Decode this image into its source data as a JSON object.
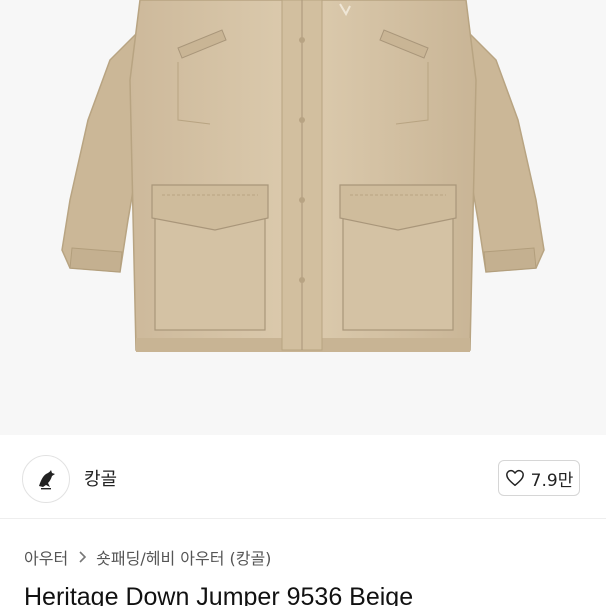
{
  "product": {
    "image_icon": "jacket-image",
    "title": "Heritage Down Jumper 9536 Beige"
  },
  "brand": {
    "name": "캉골",
    "logo_icon": "kangaroo-logo-icon"
  },
  "like": {
    "icon": "heart-outline-icon",
    "count": "7.9만"
  },
  "breadcrumb": {
    "items": [
      "아우터",
      "숏패딩/헤비 아우터 (캉골)"
    ],
    "separator_icon": "chevron-right-icon"
  },
  "colors": {
    "jacket": "#d5c3a6",
    "hero_background": "#f7f7f7",
    "border": "#d6d6d6"
  }
}
